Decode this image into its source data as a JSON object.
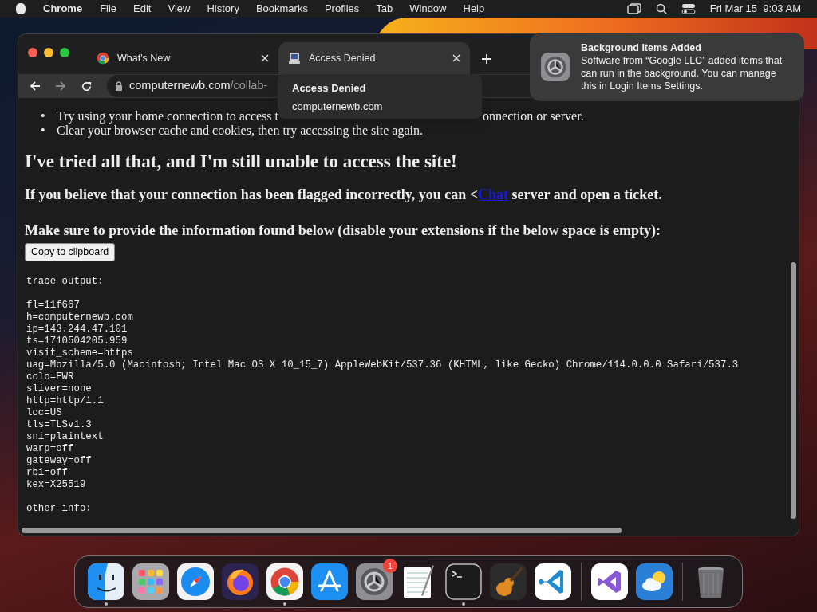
{
  "menu_bar": {
    "app": "Chrome",
    "items": [
      "File",
      "Edit",
      "View",
      "History",
      "Bookmarks",
      "Profiles",
      "Tab",
      "Window",
      "Help"
    ],
    "clock": "Fri Mar 15  9:03 AM"
  },
  "browser": {
    "tabs": [
      {
        "title": "What's New",
        "kind": "chrome",
        "selected": false
      },
      {
        "title": "Access Denied",
        "kind": "site",
        "selected": true
      }
    ],
    "address": {
      "host": "computernewb.com",
      "path": "/collab-"
    },
    "tooltip": {
      "title": "Access Denied",
      "url": "computernewb.com"
    },
    "page": {
      "bullets": [
        {
          "marker": "•",
          "parts": [
            "Try using your home connection to access t",
            "onnection or server."
          ]
        },
        {
          "marker": "•",
          "parts": [
            "Clear your browser cache and cookies, then try accessing the site again."
          ]
        }
      ],
      "heading": "I've tried all that, and I'm still unable to access the site!",
      "para_before": "If you believe that your connection has been flagged incorrectly, you can <",
      "link": "Chat",
      "para_after": " server and open a ticket.",
      "para2": "Make sure to provide the information found below (disable your extensions if the below space is empty):",
      "copy_button": "Copy to clipboard",
      "trace": [
        {
          "text": "trace output:"
        },
        {
          "text": "fl=11f667",
          "blank_before": true
        },
        {
          "text": "h=computernewb.com"
        },
        {
          "text": "ip=143.244.47.101"
        },
        {
          "text": "ts=1710504205.959"
        },
        {
          "text": "visit_scheme=https"
        },
        {
          "text": "uag=Mozilla/5.0 (Macintosh; Intel Mac OS X 10_15_7) AppleWebKit/537.36 (KHTML, like Gecko) Chrome/114.0.0.0 Safari/537.3"
        },
        {
          "text": "colo=EWR"
        },
        {
          "text": "sliver=none"
        },
        {
          "text": "http=http/1.1"
        },
        {
          "text": "loc=US"
        },
        {
          "text": "tls=TLSv1.3"
        },
        {
          "text": "sni=plaintext"
        },
        {
          "text": "warp=off"
        },
        {
          "text": "gateway=off"
        },
        {
          "text": "rbi=off"
        },
        {
          "text": "kex=X25519"
        },
        {
          "text": "other info:",
          "blank_before": true
        }
      ]
    }
  },
  "notification": {
    "title": "Background Items Added",
    "body": "Software from “Google LLC” added items that can run in the background. You can manage this in Login Items Settings."
  },
  "dock": [
    {
      "kind": "finder",
      "running": true
    },
    {
      "kind": "launchpad",
      "running": false
    },
    {
      "kind": "safari",
      "running": false
    },
    {
      "kind": "firefox",
      "running": false
    },
    {
      "kind": "chrome",
      "running": true
    },
    {
      "kind": "appstore",
      "running": false
    },
    {
      "kind": "settings",
      "running": false,
      "badge": "1"
    },
    {
      "kind": "textedit",
      "running": false
    },
    {
      "kind": "terminal",
      "running": true
    },
    {
      "kind": "garageband",
      "running": false
    },
    {
      "kind": "vscode",
      "running": false
    },
    {
      "kind": "separator"
    },
    {
      "kind": "visualstudio",
      "running": false
    },
    {
      "kind": "weather",
      "running": false
    },
    {
      "kind": "separator"
    },
    {
      "kind": "trash",
      "running": false
    }
  ]
}
